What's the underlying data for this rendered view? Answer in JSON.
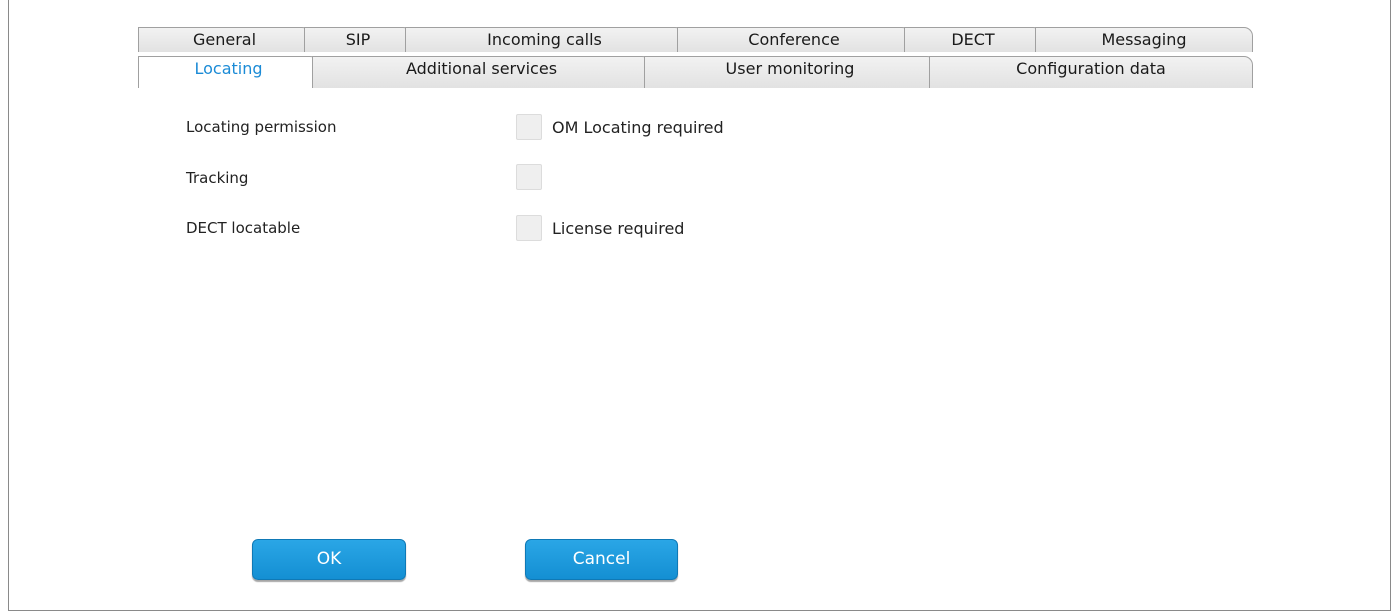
{
  "tabs": {
    "row1": [
      {
        "label": "General"
      },
      {
        "label": "SIP"
      },
      {
        "label": "Incoming calls"
      },
      {
        "label": "Conference"
      },
      {
        "label": "DECT"
      },
      {
        "label": "Messaging"
      }
    ],
    "row2": [
      {
        "label": "Locating",
        "active": true
      },
      {
        "label": "Additional services"
      },
      {
        "label": "User monitoring"
      },
      {
        "label": "Configuration data"
      }
    ]
  },
  "form": {
    "fields": [
      {
        "label": "Locating permission",
        "checked": false,
        "checkbox_text": "OM Locating required"
      },
      {
        "label": "Tracking",
        "checked": false,
        "checkbox_text": ""
      },
      {
        "label": "DECT locatable",
        "checked": false,
        "checkbox_text": "License required"
      }
    ]
  },
  "buttons": {
    "ok": "OK",
    "cancel": "Cancel"
  },
  "colors": {
    "active_tab_text": "#1b8bd6",
    "button_blue": "#1b9ad9"
  }
}
